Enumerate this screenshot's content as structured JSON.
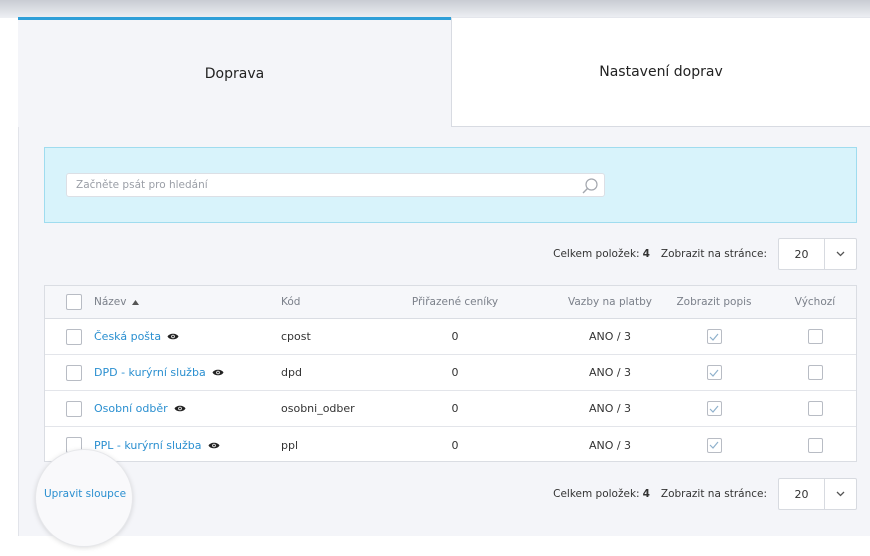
{
  "tabs": [
    {
      "label": "Doprava",
      "active": true
    },
    {
      "label": "Nastavení doprav",
      "active": false
    }
  ],
  "search": {
    "placeholder": "Začněte psát pro hledání",
    "value": ""
  },
  "pager": {
    "total_label": "Celkem položek:",
    "total_count": "4",
    "per_page_label": "Zobrazit na stránce:",
    "per_page_value": "20"
  },
  "columns": {
    "name": "Název",
    "code": "Kód",
    "pricelists": "Přiřazené ceníky",
    "payments": "Vazby na platby",
    "show_desc": "Zobrazit popis",
    "default": "Výchozí"
  },
  "rows": [
    {
      "name": "Česká pošta",
      "code": "cpost",
      "pricelists": "0",
      "payments": "ANO / 3",
      "show_desc": true,
      "default": false
    },
    {
      "name": "DPD - kurýrní služba",
      "code": "dpd",
      "pricelists": "0",
      "payments": "ANO / 3",
      "show_desc": true,
      "default": false
    },
    {
      "name": "Osobní odběr",
      "code": "osobni_odber",
      "pricelists": "0",
      "payments": "ANO / 3",
      "show_desc": true,
      "default": false
    },
    {
      "name": "PPL - kurýrní služba",
      "code": "ppl",
      "pricelists": "0",
      "payments": "ANO / 3",
      "show_desc": true,
      "default": false
    }
  ],
  "edit_columns": "Upravit sloupce",
  "colors": {
    "accent": "#2a8fd0",
    "tab_border": "#2f9fd8",
    "search_bg": "#d8f3fb"
  }
}
